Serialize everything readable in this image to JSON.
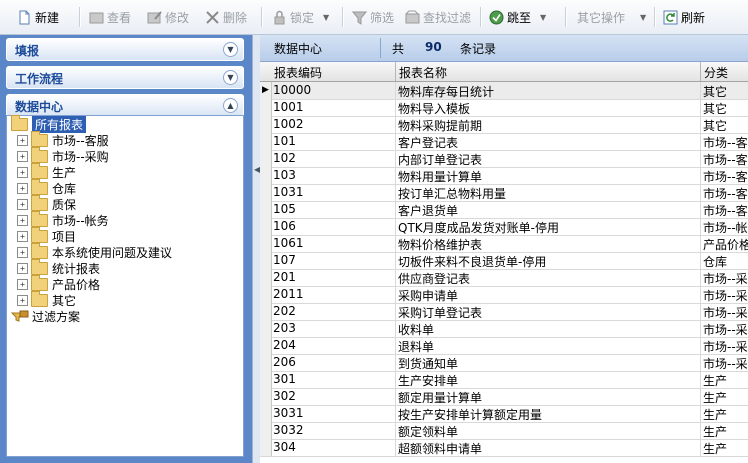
{
  "toolbar": {
    "new": "新建",
    "view": "查看",
    "edit": "修改",
    "delete": "删除",
    "lock": "锁定",
    "filter": "筛选",
    "find_filter": "查找过滤",
    "jump": "跳至",
    "other_ops": "其它操作",
    "refresh": "刷新"
  },
  "left": {
    "panels": [
      "填报",
      "工作流程",
      "数据中心"
    ],
    "tree": [
      "所有报表",
      "市场--客服",
      "市场--采购",
      "生产",
      "仓库",
      "质保",
      "市场--帐务",
      "项目",
      "本系统使用问题及建议",
      "统计报表",
      "产品价格",
      "其它"
    ],
    "filter_scheme": "过滤方案"
  },
  "right": {
    "header": {
      "title": "数据中心",
      "total_prefix": "共",
      "count": "90",
      "suffix": "条记录"
    },
    "columns": [
      "报表编码",
      "报表名称",
      "分类"
    ],
    "rows": [
      [
        "10000",
        "物料库存每日统计",
        "其它"
      ],
      [
        "1001",
        "物料导入模板",
        "其它"
      ],
      [
        "1002",
        "物料采购提前期",
        "其它"
      ],
      [
        "101",
        "客户登记表",
        "市场--客"
      ],
      [
        "102",
        "内部订单登记表",
        "市场--客"
      ],
      [
        "103",
        "物料用量计算单",
        "市场--客"
      ],
      [
        "1031",
        "按订单汇总物料用量",
        "市场--客"
      ],
      [
        "105",
        "客户退货单",
        "市场--客"
      ],
      [
        "106",
        "QTK月度成品发货对账单-停用",
        "市场--帐"
      ],
      [
        "1061",
        "物料价格维护表",
        "产品价格"
      ],
      [
        "107",
        "切板件来料不良退货单-停用",
        "仓库"
      ],
      [
        "201",
        "供应商登记表",
        "市场--采"
      ],
      [
        "2011",
        "采购申请单",
        "市场--采"
      ],
      [
        "202",
        "采购订单登记表",
        "市场--采"
      ],
      [
        "203",
        "收料单",
        "市场--采"
      ],
      [
        "204",
        "退料单",
        "市场--采"
      ],
      [
        "206",
        "到货通知单",
        "市场--采"
      ],
      [
        "301",
        "生产安排单",
        "生产"
      ],
      [
        "302",
        "额定用量计算单",
        "生产"
      ],
      [
        "3031",
        "按生产安排单计算额定用量",
        "生产"
      ],
      [
        "3032",
        "额定领料单",
        "生产"
      ],
      [
        "304",
        "超额领料申请单",
        "生产"
      ]
    ]
  }
}
